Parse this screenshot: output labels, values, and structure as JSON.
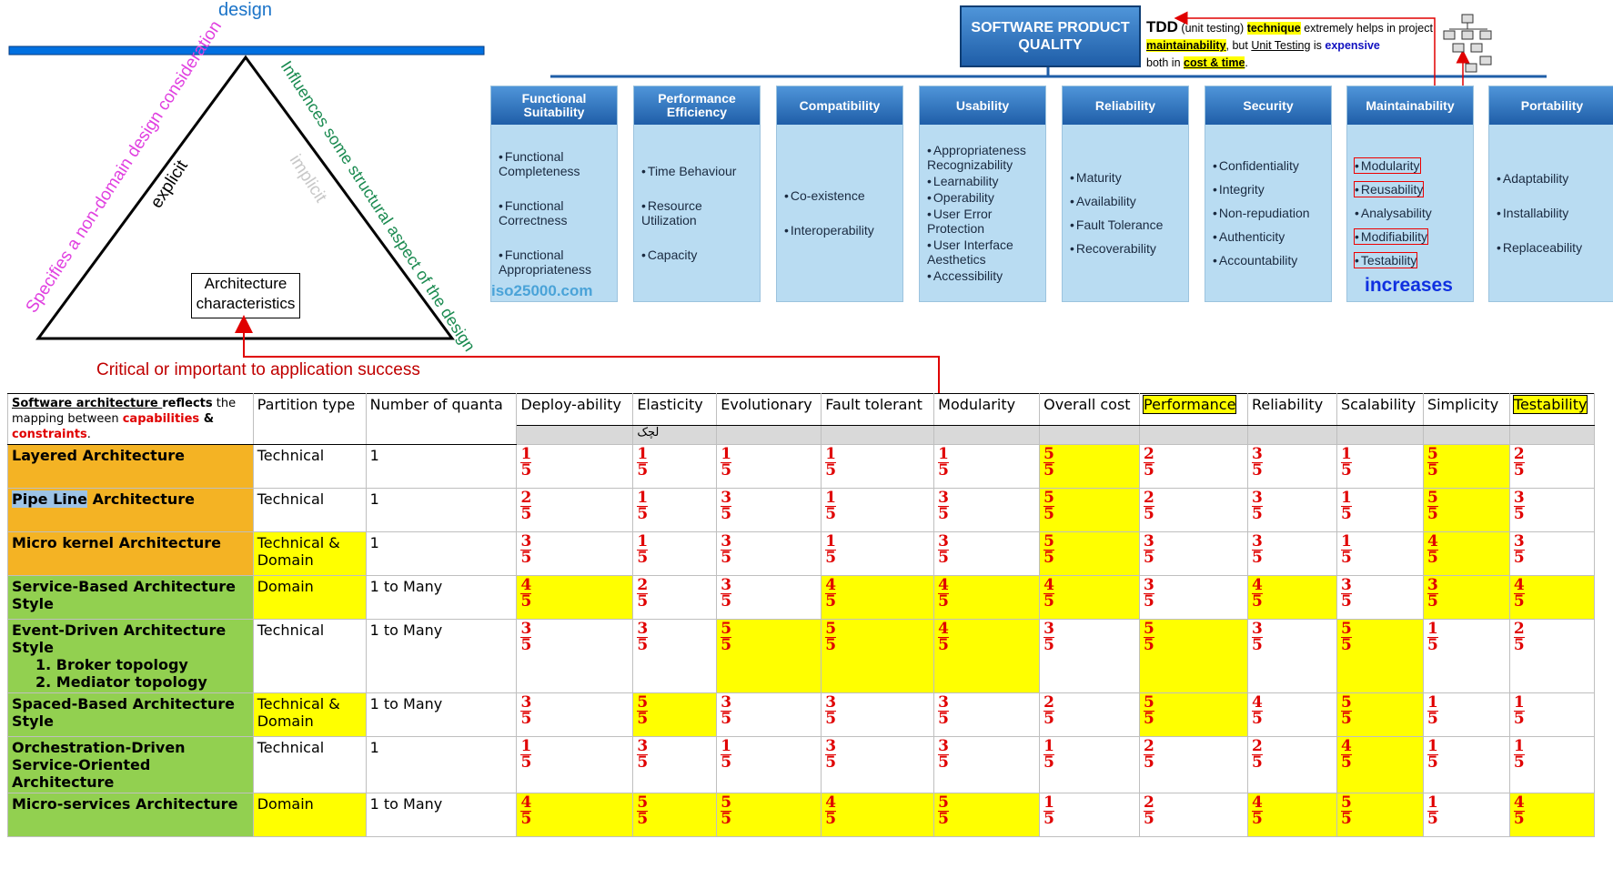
{
  "triangle": {
    "design_label": "design",
    "left_side": "Specifies a non-domain design consideration",
    "explicit": "explicit",
    "implicit": "implicit",
    "right_side": "Influences some structural aspect of the design",
    "box_line1": "Architecture",
    "box_line2": "characteristics",
    "critical": "Critical or important to application success"
  },
  "iso": {
    "title_line1": "SOFTWARE PRODUCT",
    "title_line2": "QUALITY",
    "watermark": "iso25000.com",
    "columns": [
      {
        "header": "Functional Suitability",
        "items": [
          "Functional Completeness",
          "Functional Correctness",
          "Functional Appropriateness"
        ]
      },
      {
        "header": "Performance Efficiency",
        "items": [
          "Time Behaviour",
          "Resource Utilization",
          "Capacity"
        ]
      },
      {
        "header": "Compatibility",
        "items": [
          "Co-existence",
          "Interoperability"
        ]
      },
      {
        "header": "Usability",
        "items": [
          "Appropriateness Recognizability",
          "Learnability",
          "Operability",
          "User Error Protection",
          "User Interface Aesthetics",
          "Accessibility"
        ]
      },
      {
        "header": "Reliability",
        "items": [
          "Maturity",
          "Availability",
          "Fault Tolerance",
          "Recoverability"
        ]
      },
      {
        "header": "Security",
        "items": [
          "Confidentiality",
          "Integrity",
          "Non-repudiation",
          "Authenticity",
          "Accountability"
        ]
      },
      {
        "header": "Maintainability",
        "items": [
          "Modularity",
          "Reusability",
          "Analysability",
          "Modifiability",
          "Testability"
        ]
      },
      {
        "header": "Portability",
        "items": [
          "Adaptability",
          "Installability",
          "Replaceability"
        ]
      }
    ],
    "increases": "increases",
    "tdd": {
      "t1": "TDD",
      "t2": " (unit testing) ",
      "t3": "technique",
      "t4": " extremely helps in project ",
      "t5": "maintainability",
      "t6": ", but ",
      "t7": "Unit Testing",
      "t8": " is ",
      "t9": "expensive",
      "t10": " both in ",
      "t11": "cost & time",
      "t12": "."
    }
  },
  "table": {
    "caption": {
      "c1": "Software architecture ",
      "c2": "reflects",
      "c3": " the mapping between ",
      "c4": "capabilities",
      "c5": " & ",
      "c6": "constraints",
      "c7": "."
    },
    "elasticity_note": "لچک",
    "headers": [
      "Partition type",
      "Number of quanta",
      "Deploy-ability",
      "Elasticity",
      "Evolutionary",
      "Fault tolerant",
      "Modularity",
      "Overall cost",
      "Performance",
      "Reliability",
      "Scalability",
      "Simplicity",
      "Testability"
    ],
    "highlight_headers": [
      8,
      12
    ],
    "denominator": "5",
    "rows": [
      {
        "name": "Layered Architecture",
        "name_color": "orange",
        "partition": "Technical",
        "partition_yellow": false,
        "quanta": "1",
        "ratings": [
          "1",
          "1",
          "1",
          "1",
          "1",
          "5",
          "2",
          "3",
          "1",
          "5",
          "2"
        ],
        "yellow": [
          false,
          false,
          false,
          false,
          false,
          true,
          false,
          false,
          false,
          true,
          false
        ]
      },
      {
        "name_pre": "Pipe Line",
        "name": " Architecture",
        "name_color": "orange",
        "partition": "Technical",
        "partition_yellow": false,
        "quanta": "1",
        "ratings": [
          "2",
          "1",
          "3",
          "1",
          "3",
          "5",
          "2",
          "3",
          "1",
          "5",
          "3"
        ],
        "yellow": [
          false,
          false,
          false,
          false,
          false,
          true,
          false,
          false,
          false,
          true,
          false
        ]
      },
      {
        "name": "Micro kernel Architecture",
        "name_color": "orange",
        "partition": "Technical & Domain",
        "partition_yellow": true,
        "quanta": "1",
        "ratings": [
          "3",
          "1",
          "3",
          "1",
          "3",
          "5",
          "3",
          "3",
          "1",
          "4",
          "3"
        ],
        "yellow": [
          false,
          false,
          false,
          false,
          false,
          true,
          false,
          false,
          false,
          true,
          false
        ]
      },
      {
        "name": "Service-Based Architecture Style",
        "name_color": "green",
        "partition": "Domain",
        "partition_yellow": true,
        "quanta": "1 to Many",
        "ratings": [
          "4",
          "2",
          "3",
          "4",
          "4",
          "4",
          "3",
          "4",
          "3",
          "3",
          "4"
        ],
        "yellow": [
          true,
          false,
          false,
          true,
          true,
          true,
          false,
          true,
          false,
          true,
          true
        ]
      },
      {
        "name": "Event-Driven Architecture Style",
        "sub": [
          "1. Broker topology",
          "2. Mediator topology"
        ],
        "name_color": "green",
        "partition": "Technical",
        "partition_yellow": false,
        "quanta": "1 to Many",
        "ratings": [
          "3",
          "3",
          "5",
          "5",
          "4",
          "3",
          "5",
          "3",
          "5",
          "1",
          "2"
        ],
        "yellow": [
          false,
          false,
          true,
          true,
          true,
          false,
          true,
          false,
          true,
          false,
          false
        ]
      },
      {
        "name": "Spaced-Based Architecture Style",
        "name_color": "green",
        "partition": "Technical & Domain",
        "partition_yellow": true,
        "quanta": "1 to Many",
        "ratings": [
          "3",
          "5",
          "3",
          "3",
          "3",
          "2",
          "5",
          "4",
          "5",
          "1",
          "1"
        ],
        "yellow": [
          false,
          true,
          false,
          false,
          false,
          false,
          true,
          false,
          true,
          false,
          false
        ]
      },
      {
        "name": "Orchestration-Driven Service-Oriented Architecture",
        "name_color": "green",
        "partition": "Technical",
        "partition_yellow": false,
        "quanta": "1",
        "ratings": [
          "1",
          "3",
          "1",
          "3",
          "3",
          "1",
          "2",
          "2",
          "4",
          "1",
          "1"
        ],
        "yellow": [
          false,
          false,
          false,
          false,
          false,
          false,
          false,
          false,
          true,
          false,
          false
        ]
      },
      {
        "name": "Micro-services Architecture",
        "name_color": "green",
        "partition": "Domain",
        "partition_yellow": true,
        "quanta": "1 to Many",
        "ratings": [
          "4",
          "5",
          "5",
          "4",
          "5",
          "1",
          "2",
          "4",
          "5",
          "1",
          "4"
        ],
        "yellow": [
          true,
          true,
          true,
          true,
          true,
          false,
          false,
          true,
          true,
          false,
          true
        ]
      }
    ]
  },
  "colors": {
    "red": "#e00000",
    "yellow": "#ffff00",
    "orange": "#f4b324",
    "green": "#92d050",
    "blue": "#1a73c8"
  }
}
